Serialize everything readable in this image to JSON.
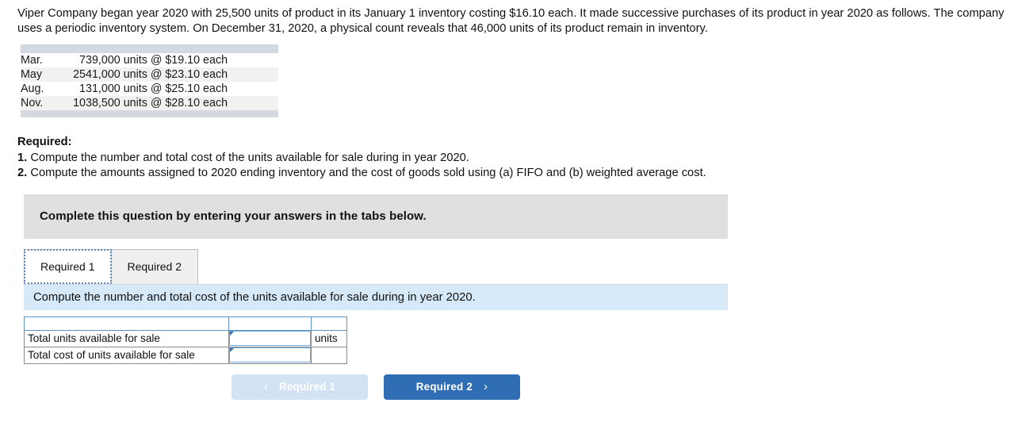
{
  "problem": {
    "intro": "Viper Company began year 2020 with 25,500 units of product in its January 1 inventory costing $16.10 each. It made successive purchases of its product in year 2020 as follows. The company uses a periodic inventory system. On December 31, 2020, a physical count reveals that 46,000 units of its product remain in inventory."
  },
  "purchases_table": {
    "rows": [
      {
        "month": "Mar.",
        "day": "7",
        "description": "39,000 units @ $19.10 each"
      },
      {
        "month": "May",
        "day": "25",
        "description": "41,000 units @ $23.10 each"
      },
      {
        "month": "Aug.",
        "day": "1",
        "description": "31,000 units @ $25.10 each"
      },
      {
        "month": "Nov.",
        "day": "10",
        "description": "38,500 units @ $28.10 each"
      }
    ]
  },
  "required": {
    "title": "Required:",
    "items": [
      {
        "num": "1.",
        "text": "Compute the number and total cost of the units available for sale during in year 2020."
      },
      {
        "num": "2.",
        "text": "Compute the amounts assigned to 2020 ending inventory and the cost of goods sold using (a) FIFO and (b) weighted average cost."
      }
    ]
  },
  "instruction_panel": {
    "text": "Complete this question by entering your answers in the tabs below."
  },
  "tabs": [
    {
      "label": "Required 1",
      "active": true
    },
    {
      "label": "Required 2",
      "active": false
    }
  ],
  "req_banner": {
    "text": "Compute the number and total cost of the units available for sale during in year 2020."
  },
  "answer_table": {
    "headers": [
      "",
      "",
      ""
    ],
    "rows": [
      {
        "label": "Total units available for sale",
        "value": "",
        "unit": "units"
      },
      {
        "label": "Total cost of units available for sale",
        "value": "",
        "unit": ""
      }
    ]
  },
  "nav": {
    "prev_label": "Required 1",
    "prev_chevron": "‹",
    "next_label": "Required 2",
    "next_chevron": "›"
  },
  "colors": {
    "header_blue": "#6fa8dc",
    "banner_blue": "#d6e9f8",
    "panel_gray": "#e0e0e0",
    "button_blue": "#2f6db4",
    "button_disabled": "#d3e3f3"
  }
}
